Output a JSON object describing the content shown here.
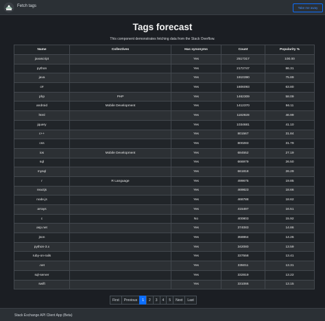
{
  "navbar": {
    "brand": "Fetch tags",
    "tour_button": "Take me away"
  },
  "header": {
    "title": "Tags forecast",
    "subtitle": "This component demonstrates fetching data from the Stack Overflow."
  },
  "table": {
    "columns": [
      "Name",
      "Collectives",
      "Has synonyms",
      "Count",
      "Popularity %"
    ],
    "rows": [
      [
        "javascript",
        "",
        "Yes",
        "2517317",
        "100.00"
      ],
      [
        "python",
        "",
        "Yes",
        "2172747",
        "86.31"
      ],
      [
        "java",
        "",
        "Yes",
        "1910390",
        "75.89"
      ],
      [
        "c#",
        "",
        "Yes",
        "1606093",
        "63.80"
      ],
      [
        "php",
        "PHP",
        "Yes",
        "1462309",
        "58.09"
      ],
      [
        "android",
        "Mobile Development",
        "Yes",
        "1412370",
        "56.11"
      ],
      [
        "html",
        "",
        "Yes",
        "1182928",
        "46.99"
      ],
      [
        "jquery",
        "",
        "Yes",
        "1034681",
        "41.10"
      ],
      [
        "c++",
        "",
        "Yes",
        "801567",
        "31.84"
      ],
      [
        "css",
        "",
        "Yes",
        "800283",
        "31.79"
      ],
      [
        "ios",
        "Mobile Development",
        "Yes",
        "684552",
        "27.19"
      ],
      [
        "sql",
        "",
        "Yes",
        "666979",
        "26.50"
      ],
      [
        "mysql",
        "",
        "Yes",
        "661818",
        "26.29"
      ],
      [
        "r",
        "R Language",
        "Yes",
        "499675",
        "19.85"
      ],
      [
        "reactjs",
        "",
        "Yes",
        "469823",
        "18.66"
      ],
      [
        "node.js",
        "",
        "Yes",
        "468788",
        "18.62"
      ],
      [
        "arrays",
        "",
        "Yes",
        "415497",
        "16.51"
      ],
      [
        "c",
        "",
        "No",
        "400803",
        "15.92"
      ],
      [
        "asp.net",
        "",
        "Yes",
        "374083",
        "14.86"
      ],
      [
        "json",
        "",
        "Yes",
        "358864",
        "14.26"
      ],
      [
        "python-3.x",
        "",
        "Yes",
        "342080",
        "13.59"
      ],
      [
        "ruby-on-rails",
        "",
        "Yes",
        "337558",
        "13.41"
      ],
      [
        ".net",
        "",
        "Yes",
        "335011",
        "13.31"
      ],
      [
        "sql-server",
        "",
        "Yes",
        "332819",
        "13.22"
      ],
      [
        "swift",
        "",
        "Yes",
        "331066",
        "13.15"
      ]
    ]
  },
  "pagination": {
    "items": [
      "First",
      "Previous",
      "1",
      "2",
      "3",
      "4",
      "5",
      "Next",
      "Last"
    ],
    "active": "1"
  },
  "footer": {
    "text": "Stack Exchange API Client App (Beta)"
  }
}
